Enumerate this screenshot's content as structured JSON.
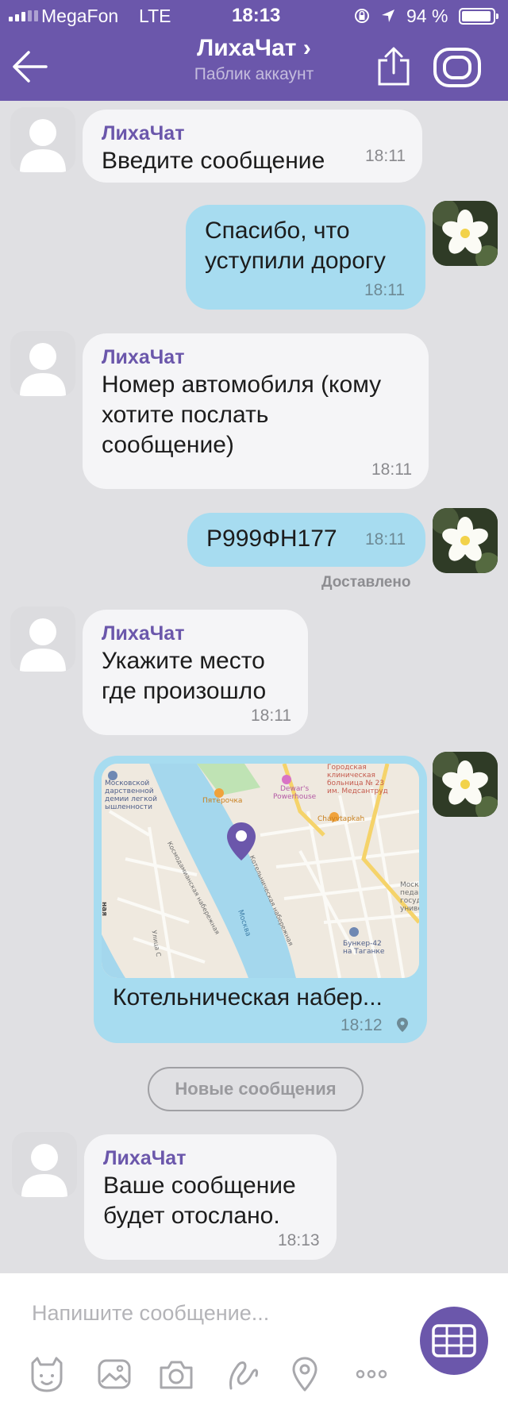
{
  "status_bar": {
    "carrier": "MegaFon",
    "network": "LTE",
    "time": "18:13",
    "battery": "94 %",
    "battery_level": 0.94
  },
  "header": {
    "title": "ЛихаЧат ›",
    "subtitle": "Паблик аккаунт",
    "accent_color": "#6b57ab"
  },
  "messages": [
    {
      "sender": "ЛихаЧат",
      "text": "Введите сообщение",
      "time": "18:11"
    },
    {
      "text_lines": [
        "Спасибо, что",
        "уступили дорогу"
      ],
      "time": "18:11"
    },
    {
      "sender": "ЛихаЧат",
      "text_lines": [
        "Номер автомобиля (кому",
        "хотите послать",
        "сообщение)"
      ],
      "time": "18:11"
    },
    {
      "text": "Р999ФН177",
      "time": "18:11",
      "status": "Доставлено"
    },
    {
      "sender": "ЛихаЧат",
      "text_lines": [
        "Укажите место",
        "где произошло"
      ],
      "time": "18:11"
    },
    {
      "type": "location",
      "caption": "Котельническая набер...",
      "time": "18:12",
      "map_labels": {
        "l1": "Московской",
        "l2": "дарственной",
        "l3": "демии легкой",
        "l4": "ышленности",
        "pyaterochka": "Пятерочка",
        "dewars1": "Dewar's",
        "dewars2": "Powerhouse",
        "hosp1": "Городская",
        "hosp2": "клиническая",
        "hosp3": "больница № 23",
        "hosp4": "им. Медсантруд",
        "chay": "Chayvtapkah",
        "mosk1": "Моск",
        "mosk2": "педаго",
        "mosk3": "государ",
        "mosk4": "униве",
        "bunker1": "Бункер-42",
        "bunker2": "на Таганке",
        "river": "Москва",
        "emb1": "Космодамианская набережная",
        "emb2": "Котельническая набережная",
        "ulitsa": "Улица С",
        "side": "ная"
      }
    },
    {
      "sender": "ЛихаЧат",
      "text_lines": [
        "Ваше сообщение",
        "будет отослано."
      ],
      "time": "18:13"
    }
  ],
  "new_messages_label": "Новые сообщения",
  "composer": {
    "placeholder": "Напишите сообщение..."
  },
  "icons": {
    "back": "arrow-left-icon",
    "share": "share-icon",
    "viber": "viber-icon",
    "sticker": "sticker-icon",
    "gallery": "gallery-icon",
    "camera": "camera-icon",
    "doodle": "doodle-icon",
    "location": "location-icon",
    "more": "more-icon",
    "keyboard": "keyboard-icon"
  }
}
